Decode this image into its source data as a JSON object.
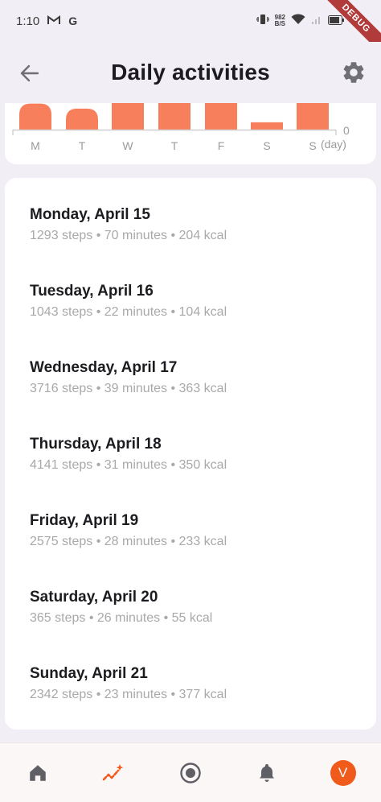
{
  "status_bar": {
    "time": "1:10",
    "left_icons": [
      "gmail-icon",
      "google-icon"
    ],
    "net_speed_value": "982",
    "net_speed_unit": "B/S",
    "right_icons": [
      "vibrate-icon",
      "wifi-icon",
      "signal-icon",
      "battery-icon"
    ]
  },
  "debug_banner": "DEBUG",
  "app_bar": {
    "back_icon": "arrow-left-icon",
    "title": "Daily activities",
    "settings_icon": "gear-icon"
  },
  "chart_data": {
    "type": "bar",
    "categories": [
      "M",
      "T",
      "W",
      "T",
      "F",
      "S",
      "S"
    ],
    "values": [
      1293,
      1043,
      3716,
      4141,
      2575,
      365,
      2342
    ],
    "axis_zero_label": "0",
    "x_unit_label": "(day)",
    "bar_color": "#f77f5c"
  },
  "days": [
    {
      "title": "Monday, April 15",
      "summary": "1293 steps • 70 minutes • 204 kcal"
    },
    {
      "title": "Tuesday, April 16",
      "summary": "1043 steps • 22 minutes • 104 kcal"
    },
    {
      "title": "Wednesday, April 17",
      "summary": "3716 steps • 39 minutes • 363 kcal"
    },
    {
      "title": "Thursday, April 18",
      "summary": "4141 steps • 31 minutes • 350 kcal"
    },
    {
      "title": "Friday, April 19",
      "summary": "2575 steps • 28 minutes • 233 kcal"
    },
    {
      "title": "Saturday, April 20",
      "summary": "365 steps • 26 minutes • 55 kcal"
    },
    {
      "title": "Sunday, April 21",
      "summary": "2342 steps • 23 minutes • 377 kcal"
    }
  ],
  "bottom_nav": {
    "items": [
      "home-icon",
      "activity-sparkle-icon",
      "record-icon",
      "bell-icon"
    ],
    "active_index": 1,
    "active_color": "#f05a1a",
    "avatar_letter": "V"
  }
}
